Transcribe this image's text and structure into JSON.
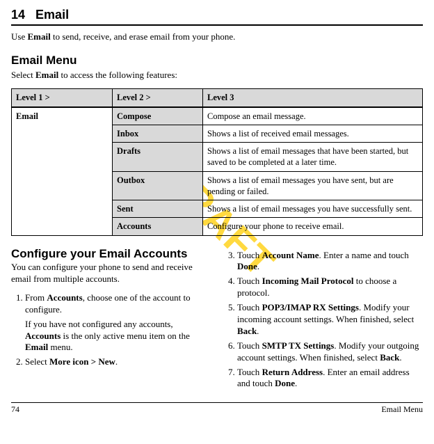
{
  "watermark": "DRAFT",
  "chapter_num": "14",
  "chapter_title": "Email",
  "intro_prefix": "Use ",
  "intro_bold": "Email",
  "intro_suffix": " to send, receive, and erase email from your phone.",
  "menu_heading": "Email Menu",
  "menu_intro_prefix": "Select ",
  "menu_intro_bold": "Email",
  "menu_intro_suffix": " to access the following features:",
  "table": {
    "headers": {
      "c1": "Level 1 >",
      "c2": "Level 2 >",
      "c3": "Level 3"
    },
    "level1": "Email",
    "rows": [
      {
        "l2": "Compose",
        "l3": "Compose an email message."
      },
      {
        "l2": "Inbox",
        "l3": "Shows a list of received email messages."
      },
      {
        "l2": "Drafts",
        "l3": "Shows a list of email messages that have been started, but saved to be completed at a later time."
      },
      {
        "l2": "Outbox",
        "l3": "Shows a list of email messages you have sent, but are pending or failed."
      },
      {
        "l2": "Sent",
        "l3": "Shows a list of email messages you have successfully sent."
      },
      {
        "l2": "Accounts",
        "l3": "Configure your phone to receive email."
      }
    ]
  },
  "configure": {
    "heading": "Configure your Email Accounts",
    "desc": "You can configure your phone to send and receive email from multiple accounts.",
    "step1_pre": "From ",
    "step1_b1": "Accounts",
    "step1_post": ", choose one of the account to configure.",
    "step1_note_pre": "If you have not configured any accounts, ",
    "step1_note_b1": "Accounts",
    "step1_note_mid": " is the only active menu item on the ",
    "step1_note_b2": "Email",
    "step1_note_post": " menu.",
    "step2_pre": "Select ",
    "step2_b1": "More icon > New",
    "step2_post": ".",
    "step3_pre": "Touch ",
    "step3_b1": "Account Name",
    "step3_mid": ". Enter a name and touch ",
    "step3_b2": "Done",
    "step3_post": ".",
    "step4_pre": "Touch ",
    "step4_b1": "Incoming Mail Protocol",
    "step4_post": " to choose a protocol.",
    "step5_pre": "Touch ",
    "step5_b1": "POP3/IMAP RX Settings",
    "step5_mid": ". Modify your incoming account settings. When finished, select ",
    "step5_b2": "Back",
    "step5_post": ".",
    "step6_pre": "Touch ",
    "step6_b1": "SMTP TX Settings",
    "step6_mid": ". Modify your outgoing account settings. When finished, select ",
    "step6_b2": "Back",
    "step6_post": ".",
    "step7_pre": "Touch ",
    "step7_b1": "Return Address",
    "step7_mid": ". Enter an email address and touch ",
    "step7_b2": "Done",
    "step7_post": "."
  },
  "footer": {
    "page": "74",
    "section": "Email Menu"
  }
}
